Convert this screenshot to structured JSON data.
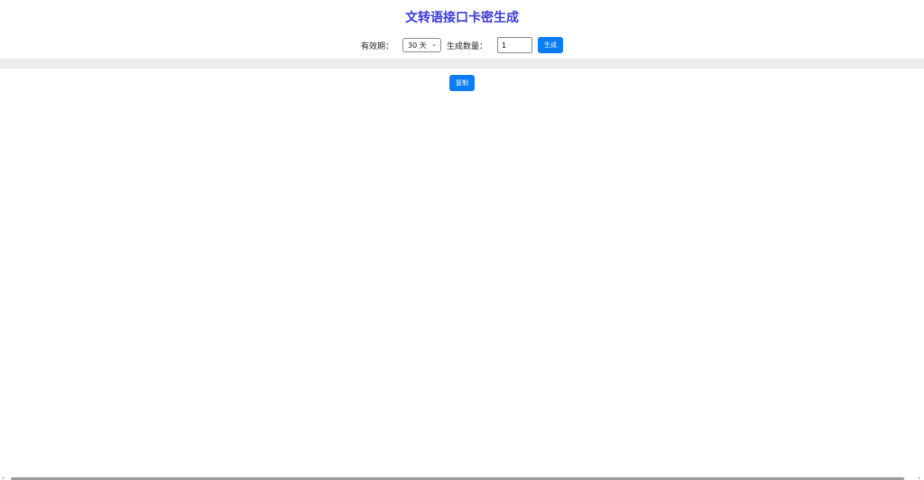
{
  "header": {
    "title": "文转语接口卡密生成"
  },
  "form": {
    "validity_label": "有效期：",
    "validity_selected": "30 天",
    "quantity_label": "生成数量：",
    "quantity_value": "1",
    "generate_label": "生成"
  },
  "output": {
    "copy_label": "复制"
  },
  "icons": {
    "select_chevron": "chevron-down-icon",
    "scroll_left": "chevron-left-icon",
    "scroll_right": "chevron-right-icon"
  },
  "colors": {
    "title": "#3b3bd6",
    "button": "#0a7cf5",
    "band": "#ececec"
  }
}
